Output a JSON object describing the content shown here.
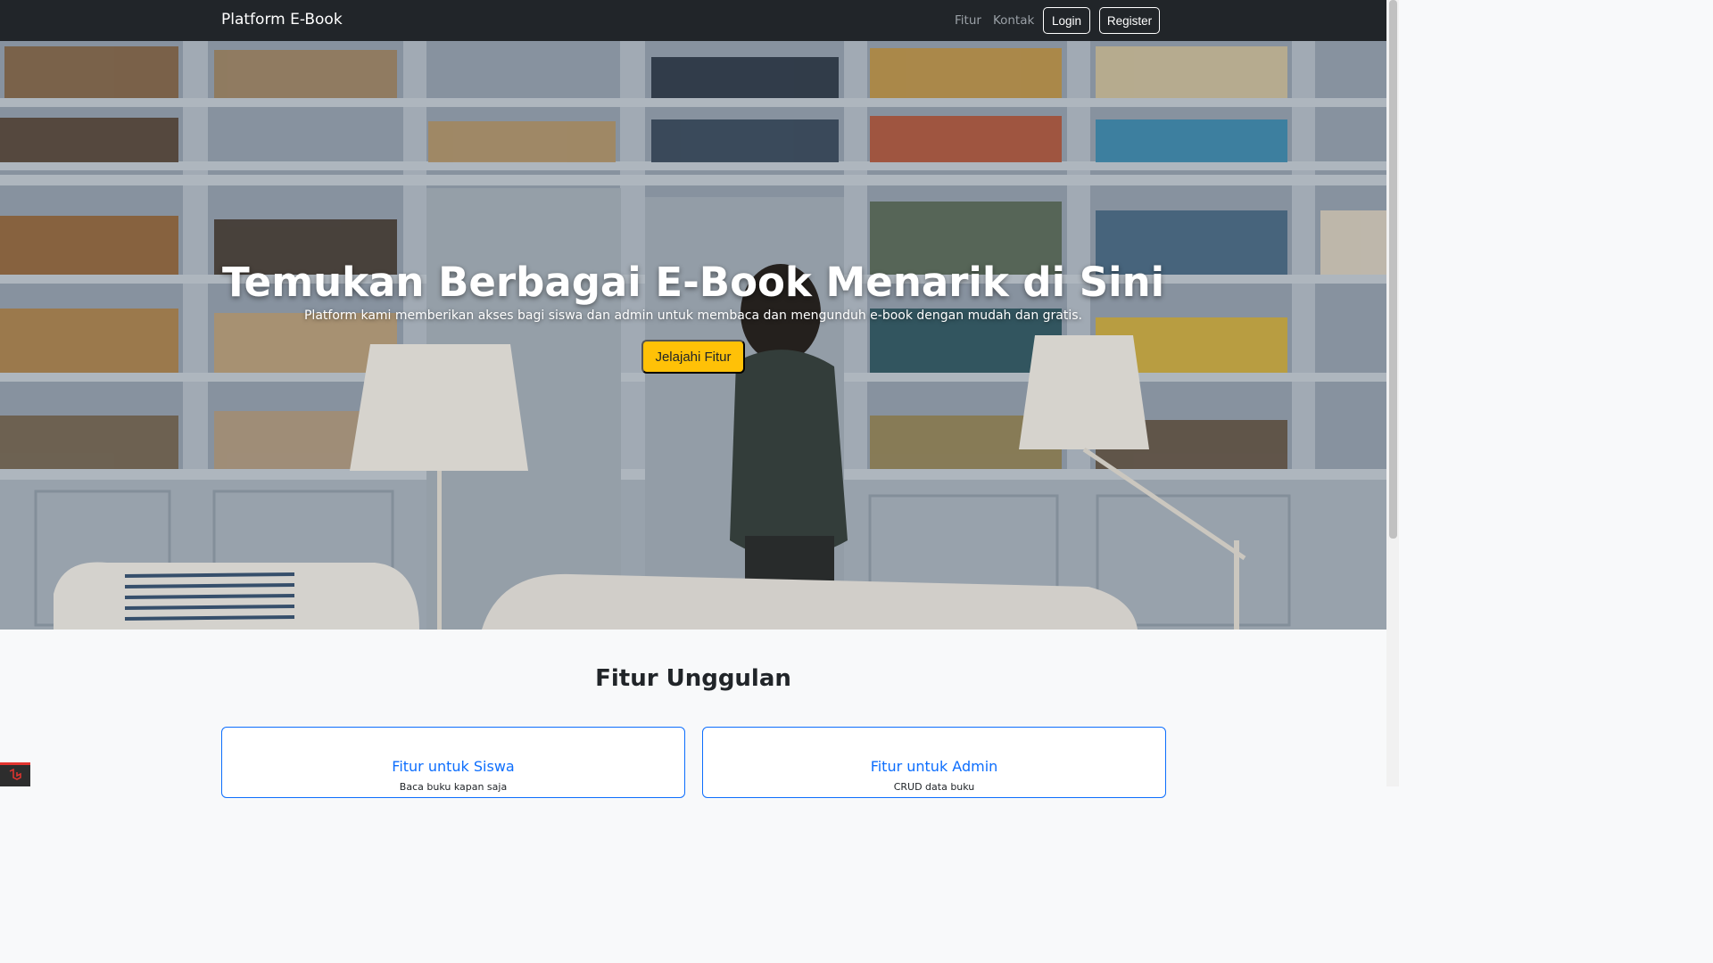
{
  "navbar": {
    "brand": "Platform E-Book",
    "links": [
      "Fitur",
      "Kontak"
    ],
    "login_label": "Login",
    "register_label": "Register"
  },
  "hero": {
    "title": "Temukan Berbagai E-Book Menarik di Sini",
    "subtitle": "Platform kami memberikan akses bagi siswa dan admin untuk membaca dan mengunduh e-book dengan mudah dan gratis.",
    "cta_label": "Jelajahi Fitur"
  },
  "features": {
    "title": "Fitur Unggulan",
    "cards": [
      {
        "title": "Fitur untuk Siswa",
        "text": "Baca buku kapan saja"
      },
      {
        "title": "Fitur untuk Admin",
        "text": "CRUD data buku"
      }
    ]
  },
  "colors": {
    "navbar_bg": "#212529",
    "accent_blue": "#0d6efd",
    "warning": "#ffc107"
  },
  "icons": {
    "debug_badge": "laravel-logo-icon"
  }
}
